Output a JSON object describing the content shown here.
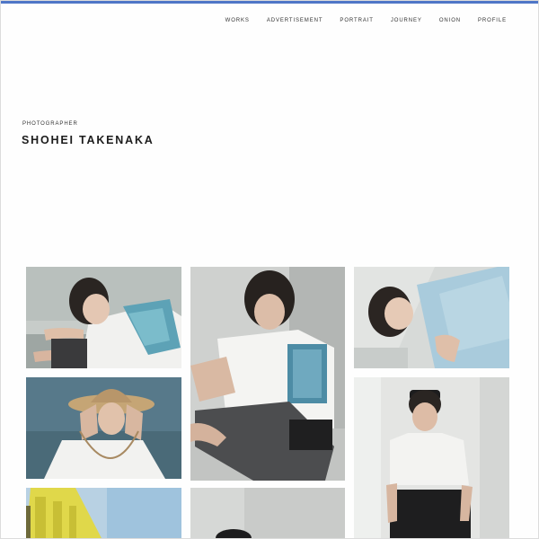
{
  "nav": {
    "items": [
      "WORKS",
      "ADVERTISEMENT",
      "PORTRAIT",
      "JOURNEY",
      "ONION",
      "PROFILE"
    ]
  },
  "hero": {
    "subtitle": "PHOTOGRAPHER",
    "title": "SHOHEI TAKENAKA"
  },
  "gallery": {
    "photos": [
      {
        "subject": "girl lying with blue art print t-shirt back"
      },
      {
        "subject": "girl seated on floor, white t-shirt with blue flower print"
      },
      {
        "subject": "girl reclining, light blue t-shirt"
      },
      {
        "subject": "girl in straw hat, white t-shirt"
      },
      {
        "subject": "girl in black cap standing, white t-shirt"
      },
      {
        "subject": "yellow building against blue sky"
      },
      {
        "subject": "person portrait, partially visible"
      }
    ]
  },
  "colors": {
    "accent_bar": "#4f76c7",
    "text": "#1c1c1c",
    "background": "#ffffff"
  }
}
